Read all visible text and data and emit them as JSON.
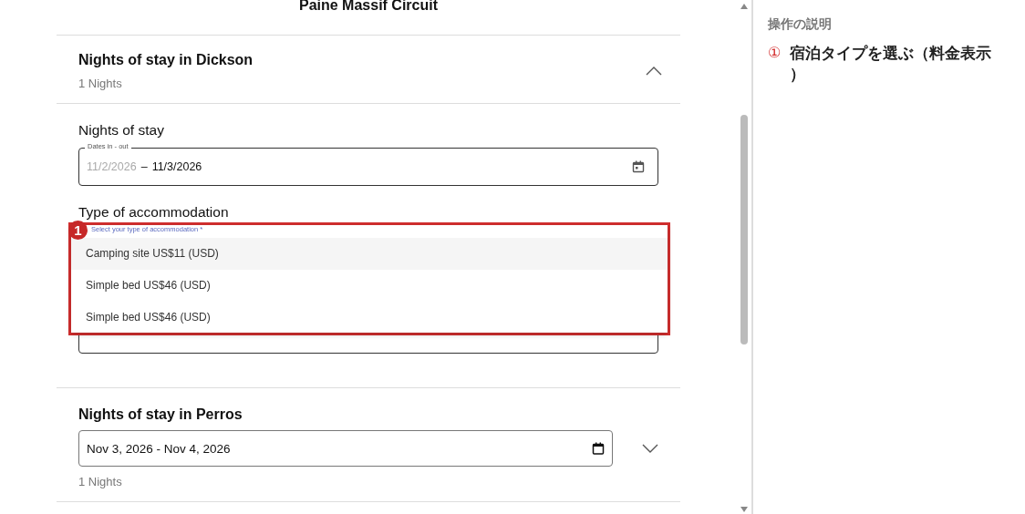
{
  "page_title": "Paine Massif Circuit",
  "stays": [
    {
      "kind": "expanded",
      "title": "Nights of stay in Dickson",
      "nights": "1 Nights",
      "expanded": true,
      "nights_label": "Nights of stay",
      "dates_field": {
        "label": "Dates in - out",
        "start": "11/2/2026",
        "separator": "–",
        "end": "11/3/2026"
      },
      "accommodation_label": "Type of accommodation",
      "dropdown": {
        "label": "Select your type of accommodation *",
        "options": [
          {
            "label": "Camping site US$11 (USD)",
            "selected": true
          },
          {
            "label": "Simple bed US$46 (USD)",
            "selected": false
          },
          {
            "label": "Simple bed US$46 (USD)",
            "selected": false
          }
        ]
      },
      "annotation": "1"
    },
    {
      "kind": "collapsed",
      "title": "Nights of stay in Perros",
      "dates": "Nov 3, 2026 - Nov 4, 2026",
      "nights": "1 Nights",
      "expanded": false
    }
  ],
  "instructions": {
    "heading": "操作の説明",
    "steps": [
      {
        "number": "①",
        "text": "宿泊タイプを選ぶ（料金表示）"
      }
    ]
  }
}
